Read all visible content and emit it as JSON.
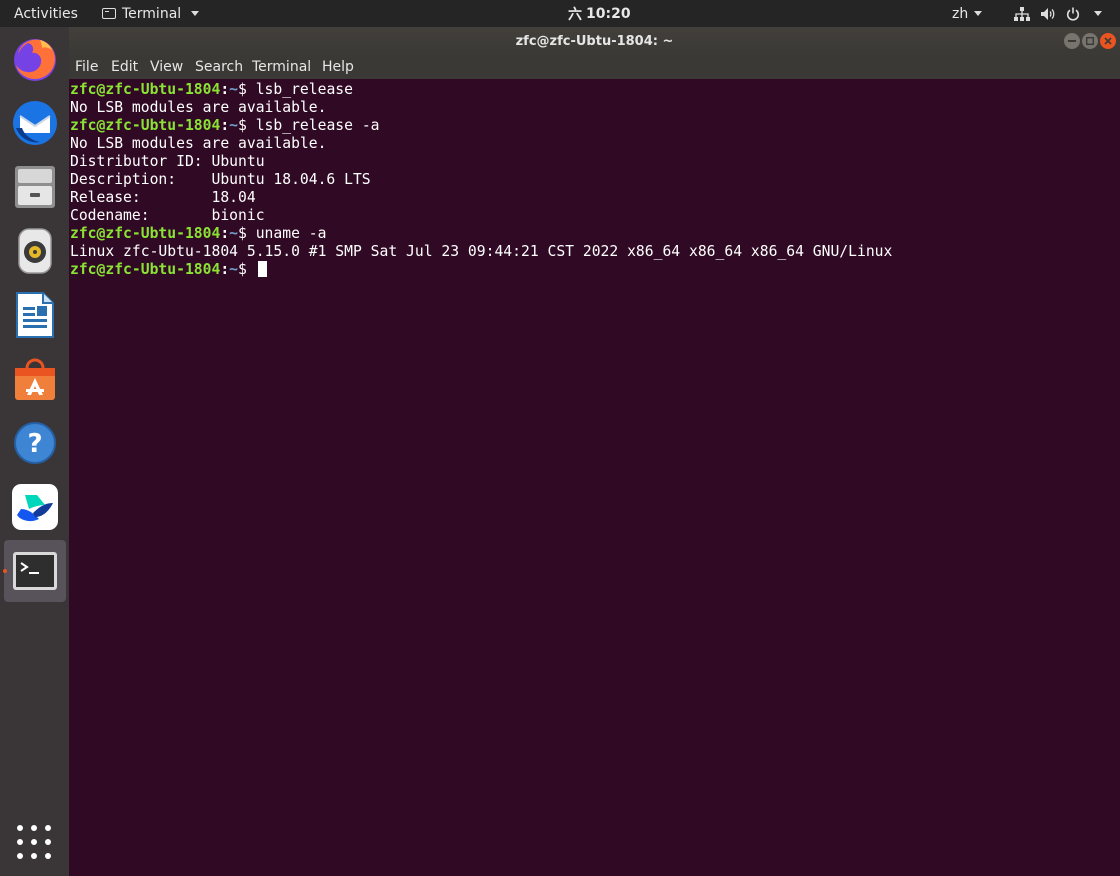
{
  "topbar": {
    "activities": "Activities",
    "app_menu": "Terminal",
    "clock_day": "六",
    "clock_time": "10:20",
    "language": "zh"
  },
  "dock": {
    "apps": [
      "firefox-icon",
      "thunderbird-icon",
      "files-icon",
      "rhythmbox-icon",
      "libreoffice-writer-icon",
      "software-center-icon",
      "help-icon",
      "feishu-icon",
      "terminal-icon"
    ],
    "active": "terminal-icon"
  },
  "window": {
    "title": "zfc@zfc-Ubtu-1804: ~",
    "menu": [
      "File",
      "Edit",
      "View",
      "Search",
      "Terminal",
      "Help"
    ]
  },
  "terminal": {
    "prompt_user": "zfc@zfc-Ubtu-1804",
    "prompt_sep": ":",
    "prompt_path": "~",
    "prompt_end": "$ ",
    "lines": [
      {
        "type": "cmd",
        "text": "lsb_release"
      },
      {
        "type": "out",
        "text": "No LSB modules are available."
      },
      {
        "type": "cmd",
        "text": "lsb_release -a"
      },
      {
        "type": "out",
        "text": "No LSB modules are available."
      },
      {
        "type": "out",
        "text": "Distributor ID: Ubuntu"
      },
      {
        "type": "out",
        "text": "Description:    Ubuntu 18.04.6 LTS"
      },
      {
        "type": "out",
        "text": "Release:        18.04"
      },
      {
        "type": "out",
        "text": "Codename:       bionic"
      },
      {
        "type": "cmd",
        "text": "uname -a"
      },
      {
        "type": "out",
        "text": "Linux zfc-Ubtu-1804 5.15.0 #1 SMP Sat Jul 23 09:44:21 CST 2022 x86_64 x86_64 x86_64 GNU/Linux"
      },
      {
        "type": "cmd",
        "text": ""
      }
    ]
  },
  "colors": {
    "terminal_bg": "#300a24",
    "prompt_user": "#8ae234",
    "prompt_path": "#729fcf",
    "accent": "#e95420"
  }
}
